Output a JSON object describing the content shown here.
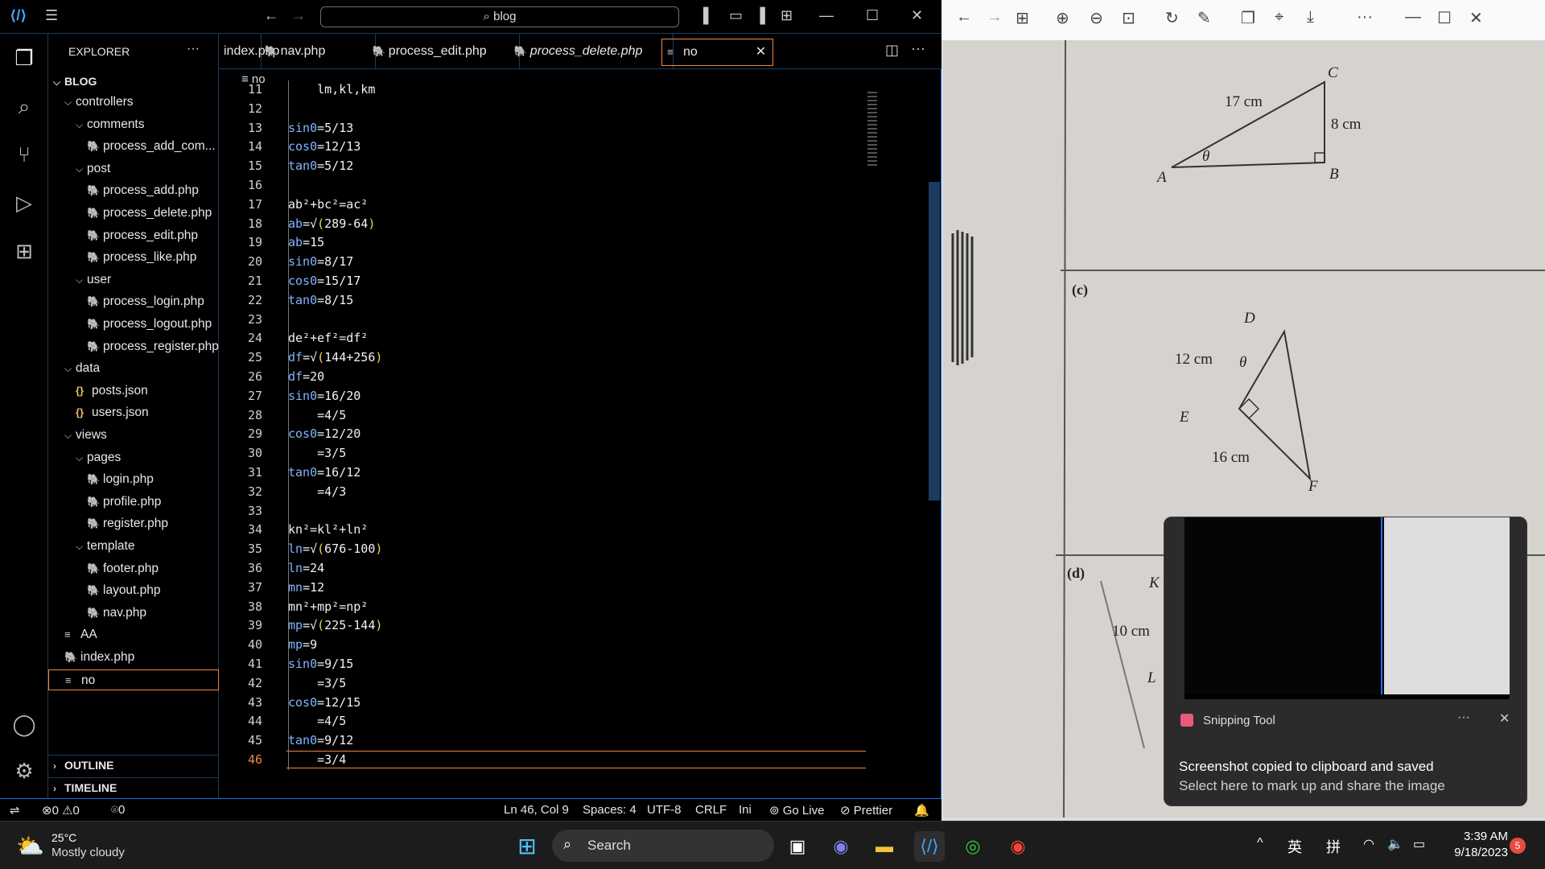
{
  "vscode": {
    "search_label": "blog",
    "explorer_title": "EXPLORER",
    "root_folder": "BLOG",
    "tree": [
      {
        "label": "controllers",
        "kind": "folder",
        "depth": 1
      },
      {
        "label": "comments",
        "kind": "folder",
        "depth": 2
      },
      {
        "label": "process_add_com...",
        "kind": "php",
        "depth": 3
      },
      {
        "label": "post",
        "kind": "folder",
        "depth": 2
      },
      {
        "label": "process_add.php",
        "kind": "php",
        "depth": 3
      },
      {
        "label": "process_delete.php",
        "kind": "php",
        "depth": 3
      },
      {
        "label": "process_edit.php",
        "kind": "php",
        "depth": 3
      },
      {
        "label": "process_like.php",
        "kind": "php",
        "depth": 3
      },
      {
        "label": "user",
        "kind": "folder",
        "depth": 2
      },
      {
        "label": "process_login.php",
        "kind": "php",
        "depth": 3
      },
      {
        "label": "process_logout.php",
        "kind": "php",
        "depth": 3
      },
      {
        "label": "process_register.php",
        "kind": "php",
        "depth": 3
      },
      {
        "label": "data",
        "kind": "folder",
        "depth": 1
      },
      {
        "label": "posts.json",
        "kind": "json",
        "depth": 2
      },
      {
        "label": "users.json",
        "kind": "json",
        "depth": 2
      },
      {
        "label": "views",
        "kind": "folder",
        "depth": 1
      },
      {
        "label": "pages",
        "kind": "folder",
        "depth": 2
      },
      {
        "label": "login.php",
        "kind": "php",
        "depth": 3
      },
      {
        "label": "profile.php",
        "kind": "php",
        "depth": 3
      },
      {
        "label": "register.php",
        "kind": "php",
        "depth": 3
      },
      {
        "label": "template",
        "kind": "folder",
        "depth": 2
      },
      {
        "label": "footer.php",
        "kind": "php",
        "depth": 3
      },
      {
        "label": "layout.php",
        "kind": "php",
        "depth": 3
      },
      {
        "label": "nav.php",
        "kind": "php",
        "depth": 3
      },
      {
        "label": "AA",
        "kind": "txt",
        "depth": 1
      },
      {
        "label": "index.php",
        "kind": "php",
        "depth": 1
      },
      {
        "label": "no",
        "kind": "txt",
        "depth": 1,
        "selected": true
      }
    ],
    "outline_label": "OUTLINE",
    "timeline_label": "TIMELINE",
    "tabs": [
      {
        "label": "index.php",
        "icon": "none",
        "italic": false
      },
      {
        "label": "nav.php",
        "icon": "php",
        "italic": false
      },
      {
        "label": "process_edit.php",
        "icon": "php",
        "italic": false
      },
      {
        "label": "process_delete.php",
        "icon": "php",
        "italic": true
      },
      {
        "label": "no",
        "icon": "txt",
        "italic": false,
        "active": true
      }
    ],
    "breadcrumb": "no",
    "lines": [
      {
        "n": "11",
        "text": "    lm,kl,km"
      },
      {
        "n": "12",
        "text": ""
      },
      {
        "n": "13",
        "text": "sin0=5/13"
      },
      {
        "n": "14",
        "text": "cos0=12/13"
      },
      {
        "n": "15",
        "text": "tan0=5/12"
      },
      {
        "n": "16",
        "text": ""
      },
      {
        "n": "17",
        "text": "ab²+bc²=ac²"
      },
      {
        "n": "18",
        "text": "ab=√(289-64)"
      },
      {
        "n": "19",
        "text": "ab=15"
      },
      {
        "n": "20",
        "text": "sin0=8/17"
      },
      {
        "n": "21",
        "text": "cos0=15/17"
      },
      {
        "n": "22",
        "text": "tan0=8/15"
      },
      {
        "n": "23",
        "text": ""
      },
      {
        "n": "24",
        "text": "de²+ef²=df²"
      },
      {
        "n": "25",
        "text": "df=√(144+256)"
      },
      {
        "n": "26",
        "text": "df=20"
      },
      {
        "n": "27",
        "text": "sin0=16/20"
      },
      {
        "n": "28",
        "text": "    =4/5"
      },
      {
        "n": "29",
        "text": "cos0=12/20"
      },
      {
        "n": "30",
        "text": "    =3/5"
      },
      {
        "n": "31",
        "text": "tan0=16/12"
      },
      {
        "n": "32",
        "text": "    =4/3"
      },
      {
        "n": "33",
        "text": ""
      },
      {
        "n": "34",
        "text": "kn²=kl²+ln²"
      },
      {
        "n": "35",
        "text": "ln=√(676-100)"
      },
      {
        "n": "36",
        "text": "ln=24"
      },
      {
        "n": "37",
        "text": "mn=12"
      },
      {
        "n": "38",
        "text": "mn²+mp²=np²"
      },
      {
        "n": "39",
        "text": "mp=√(225-144)"
      },
      {
        "n": "40",
        "text": "mp=9"
      },
      {
        "n": "41",
        "text": "sin0=9/15"
      },
      {
        "n": "42",
        "text": "    =3/5"
      },
      {
        "n": "43",
        "text": "cos0=12/15"
      },
      {
        "n": "44",
        "text": "    =4/5"
      },
      {
        "n": "45",
        "text": "tan0=9/12"
      },
      {
        "n": "46",
        "text": "    =3/4"
      }
    ],
    "current_line": "46",
    "status": {
      "errors": "0",
      "warnings": "0",
      "ports": "0",
      "position": "Ln 46, Col 9",
      "spaces": "Spaces: 4",
      "encoding": "UTF-8",
      "eol": "CRLF",
      "language": "Ini",
      "golive": "Go Live",
      "prettier": "Prettier"
    }
  },
  "photo": {
    "fig1": {
      "hyp": "17 cm",
      "side": "8 cm",
      "A": "A",
      "B": "B",
      "C": "C",
      "theta": "θ"
    },
    "fig2": {
      "label": "(c)",
      "de": "12 cm",
      "ef": "16 cm",
      "D": "D",
      "E": "E",
      "F": "F",
      "theta": "θ"
    },
    "fig3": {
      "label": "(d)",
      "K": "K",
      "L": "L",
      "side": "10 cm"
    }
  },
  "toast": {
    "app": "Snipping Tool",
    "title": "Screenshot copied to clipboard and saved",
    "subtitle": "Select here to mark up and share the image"
  },
  "taskbar": {
    "weather_temp": "25°C",
    "weather_desc": "Mostly cloudy",
    "search": "Search",
    "ime1": "英",
    "ime2": "拼",
    "time": "3:39 AM",
    "date": "9/18/2023",
    "notif_count": "5"
  },
  "colors": {
    "accent_orange": "#f0883e",
    "var_blue": "#7fb5ff",
    "paren_yellow": "#f7d35a",
    "php_purple": "#b180d7",
    "border_blue": "#1f6feb"
  }
}
